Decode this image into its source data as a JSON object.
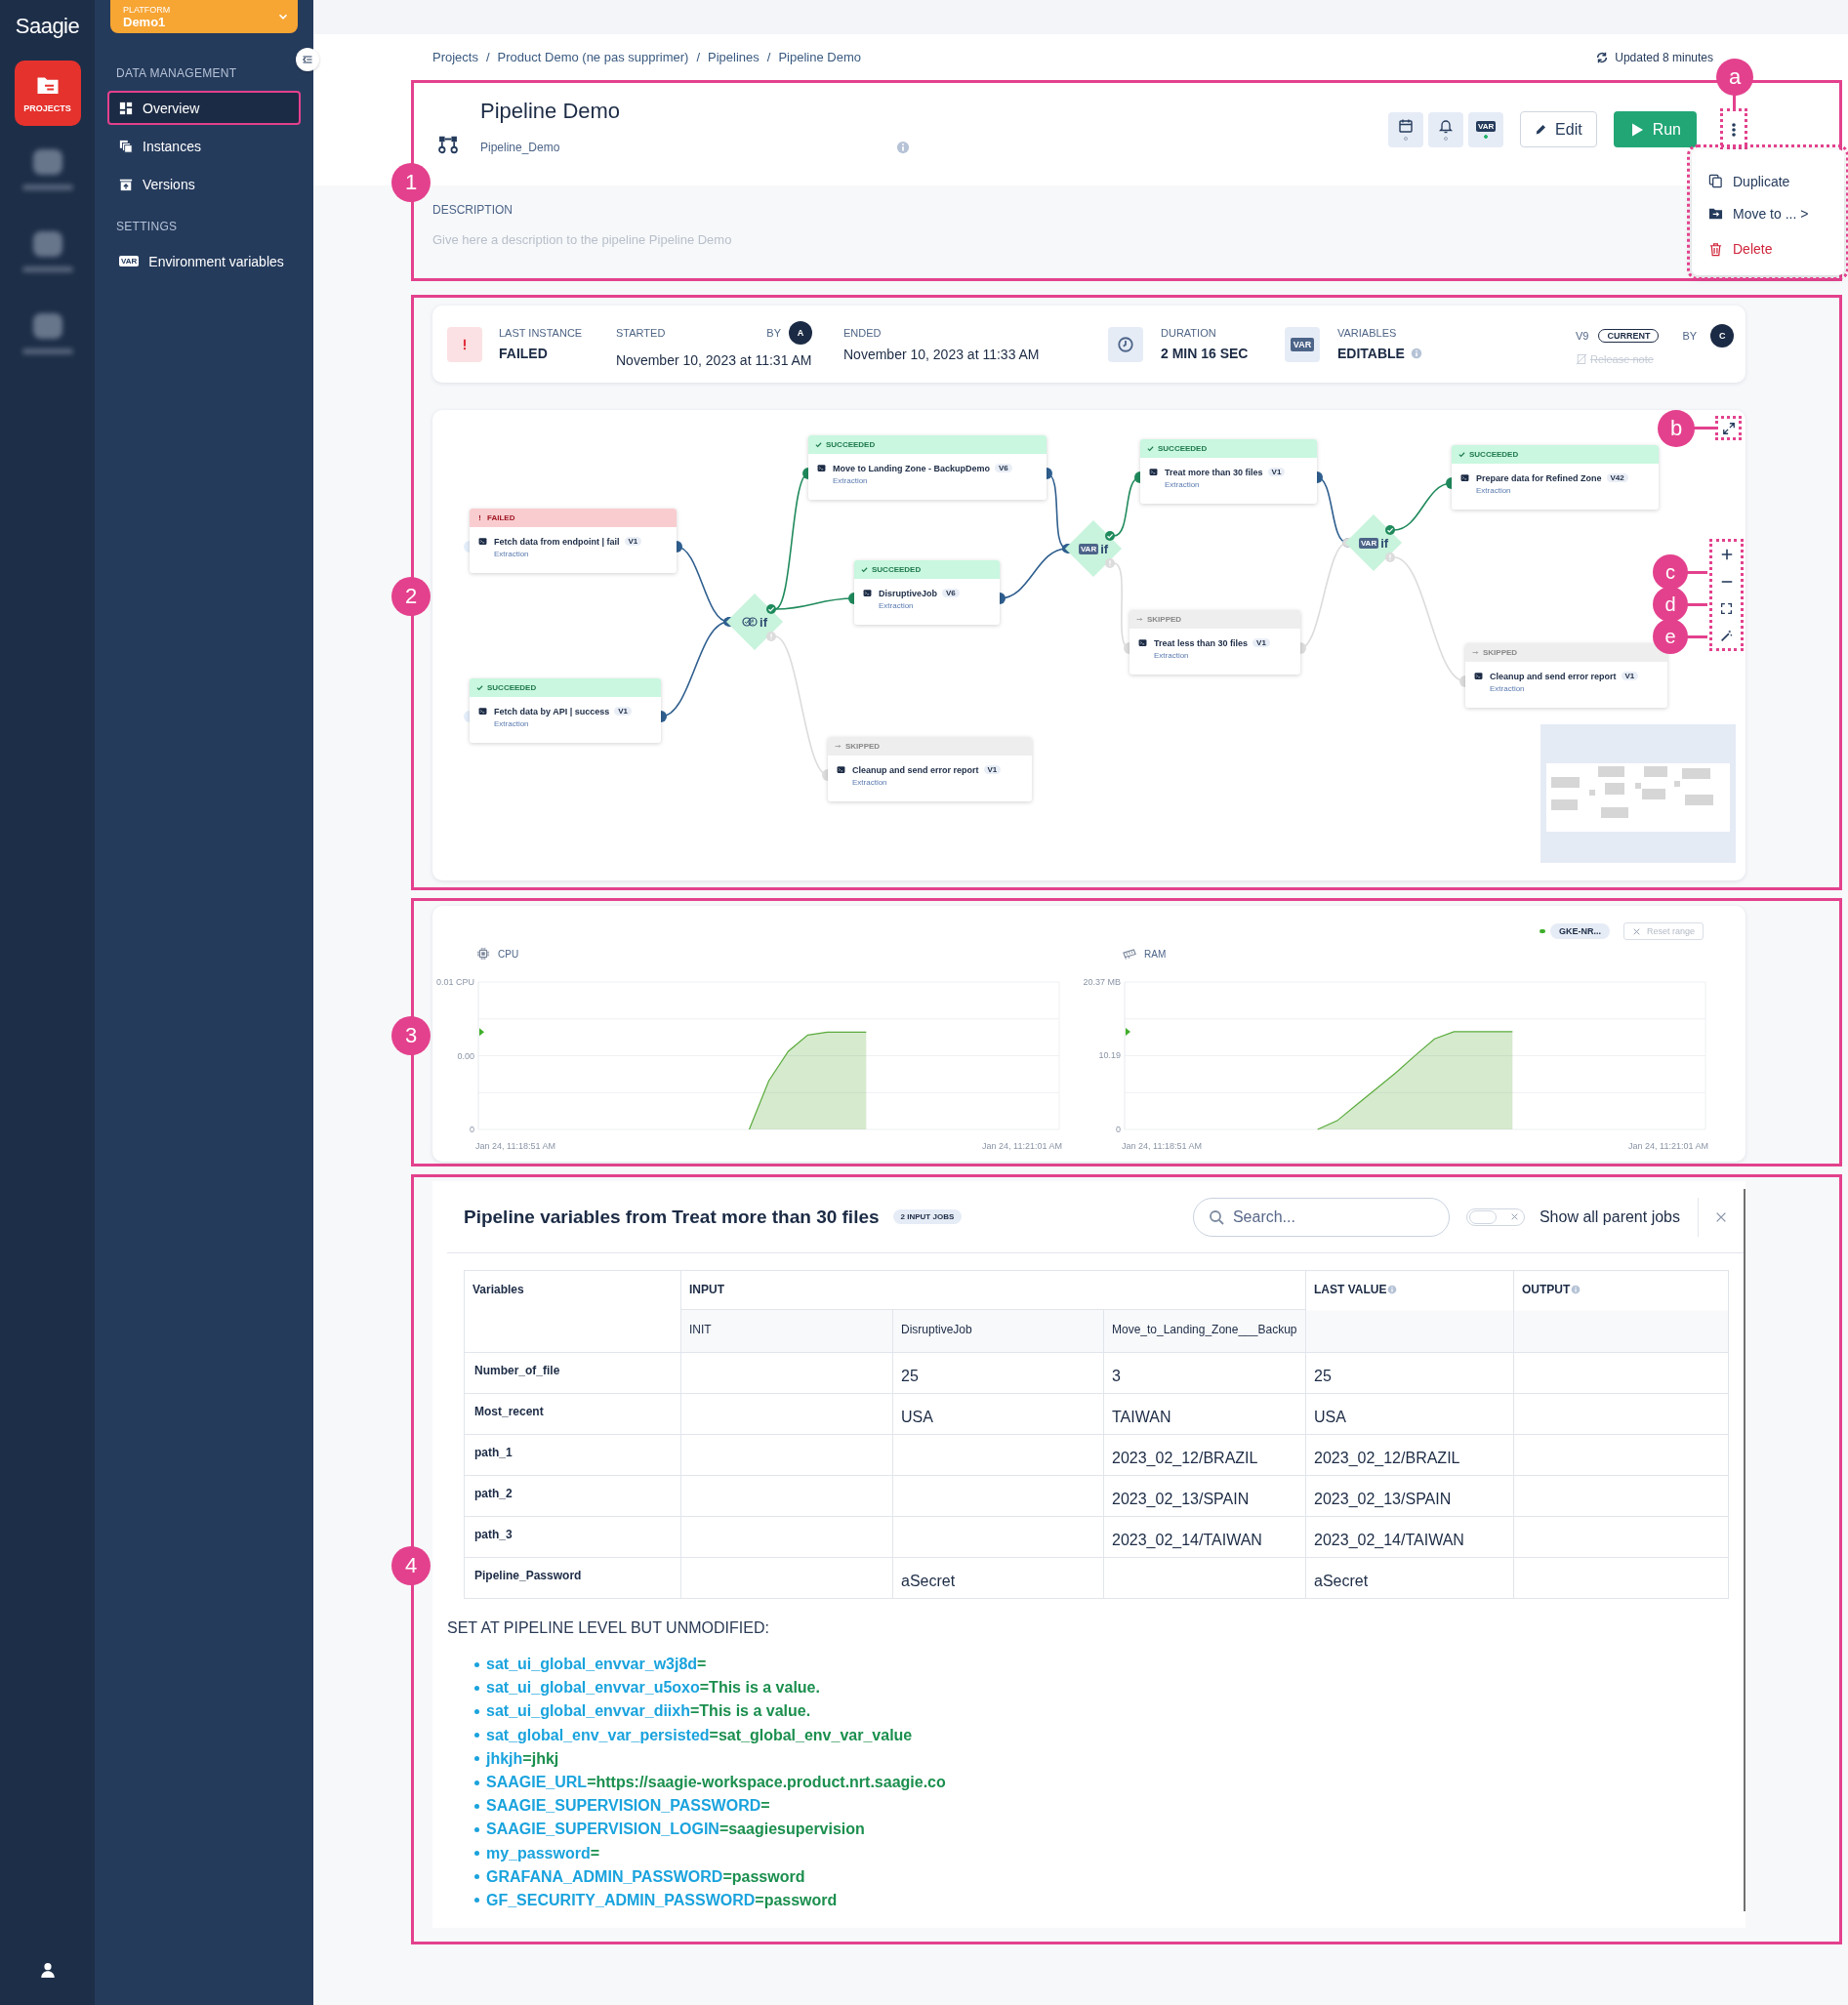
{
  "rail": {
    "logo": "Saagie",
    "items": [
      {
        "label": "PROJECTS",
        "selected": true
      }
    ]
  },
  "platform": {
    "caption": "PLATFORM",
    "name": "Demo1"
  },
  "sidebar": {
    "sections": [
      {
        "title": "DATA MANAGEMENT",
        "items": [
          {
            "label": "Overview",
            "selected": true
          },
          {
            "label": "Instances",
            "selected": false
          },
          {
            "label": "Versions",
            "selected": false
          }
        ]
      },
      {
        "title": "SETTINGS",
        "items": [
          {
            "label": "Environment variables",
            "icon_text": "VAR",
            "selected": false
          }
        ]
      }
    ]
  },
  "breadcrumb": {
    "items": [
      "Projects",
      "Product Demo (ne pas supprimer)",
      "Pipelines",
      "Pipeline Demo"
    ],
    "separator": "/"
  },
  "updated": "Updated 8 minutes",
  "pipeline": {
    "title": "Pipeline Demo",
    "technical_name": "Pipeline_Demo",
    "tools": [
      {
        "kind": "calendar",
        "active": false
      },
      {
        "kind": "bell",
        "active": false
      },
      {
        "kind": "var",
        "icon_text": "VAR",
        "active": true
      }
    ],
    "edit": "Edit",
    "run": "Run",
    "menu": [
      {
        "kind": "duplicate",
        "label": "Duplicate"
      },
      {
        "kind": "move",
        "label": "Move to ... >"
      },
      {
        "kind": "delete",
        "label": "Delete"
      }
    ],
    "description": {
      "label": "DESCRIPTION",
      "placeholder": "Give here a description to the pipeline Pipeline Demo"
    }
  },
  "instance": {
    "kind": "failed",
    "status_label": "LAST INSTANCE",
    "status_text": "FAILED",
    "started_label": "STARTED",
    "started": "November 10, 2023 at 11:31 AM",
    "by_label": "BY",
    "started_by": "A",
    "ended_label": "ENDED",
    "ended": "November 10, 2023 at 11:33 AM",
    "duration_label": "DURATION",
    "duration": "2 MIN 16 SEC",
    "variables_label": "VARIABLES",
    "variables_icon_text": "VAR",
    "variables": "EDITABLE",
    "version": "V9",
    "version_badge": "CURRENT",
    "version_by_label": "BY",
    "version_by": "C",
    "release_note": "Release note",
    "release_note_disabled": true
  },
  "graph": {
    "nodes": [
      {
        "kind": "failed",
        "status_label": "FAILED",
        "name": "Fetch data from endpoint | fail",
        "version": "V1",
        "category": "Extraction"
      },
      {
        "kind": "succeeded",
        "status_label": "SUCCEEDED",
        "name": "Fetch data by API | success",
        "version": "V1",
        "category": "Extraction"
      },
      {
        "kind": "status_condition",
        "label": "if"
      },
      {
        "kind": "succeeded",
        "status_label": "SUCCEEDED",
        "name": "Move to Landing Zone - BackupDemo",
        "version": "V6",
        "category": "Extraction"
      },
      {
        "kind": "succeeded",
        "status_label": "SUCCEEDED",
        "name": "DisruptiveJob",
        "version": "V6",
        "category": "Extraction"
      },
      {
        "kind": "skipped",
        "status_label": "SKIPPED",
        "name": "Cleanup and send error report",
        "version": "V1",
        "category": "Extraction"
      },
      {
        "kind": "variable_condition",
        "icon_text": "VAR",
        "label": "if"
      },
      {
        "kind": "succeeded",
        "status_label": "SUCCEEDED",
        "name": "Treat more than 30 files",
        "version": "V1",
        "category": "Extraction"
      },
      {
        "kind": "skipped",
        "status_label": "SKIPPED",
        "name": "Treat less than 30 files",
        "version": "V1",
        "category": "Extraction"
      },
      {
        "kind": "variable_condition",
        "icon_text": "VAR",
        "label": "if"
      },
      {
        "kind": "succeeded",
        "status_label": "SUCCEEDED",
        "name": "Prepare data for Refined Zone",
        "version": "V42",
        "category": "Extraction"
      },
      {
        "kind": "skipped",
        "status_label": "SKIPPED",
        "name": "Cleanup and send error report",
        "version": "V1",
        "category": "Extraction"
      }
    ]
  },
  "monitoring": {
    "legend": {
      "label": "GKE-NR...",
      "color": "#3fae2a"
    },
    "reset": {
      "label": "Reset range",
      "disabled": true
    },
    "charts": [
      {
        "kind": "cpu",
        "chart_data": {
          "type": "area",
          "title": "CPU",
          "categories": [
            "Jan 24, 11:18:51 AM",
            null,
            null,
            null,
            null,
            null,
            null,
            null,
            null,
            null,
            null,
            null,
            null,
            null,
            null,
            null,
            null,
            null,
            null,
            null,
            null,
            null,
            null,
            null,
            null,
            null,
            "Jan 24, 11:21:01 AM"
          ],
          "series": [
            {
              "color": "#5aab3c",
              "values": [
                null,
                null,
                null,
                null,
                null,
                null,
                null,
                null,
                null,
                null,
                null,
                null,
                0,
                0.0033,
                0.0053,
                0.0064,
                0.0066,
                0.0066,
                0.0066,
                null,
                null,
                null,
                null,
                null,
                null,
                null,
                null
              ]
            }
          ],
          "ylim": [
            0,
            0.01
          ],
          "yticks": [
            {
              "value": 0,
              "label": "0"
            },
            {
              "value": 0.005,
              "label": "0.00"
            },
            {
              "value": 0.01,
              "label": "0.01 CPU"
            }
          ]
        }
      },
      {
        "kind": "ram",
        "chart_data": {
          "type": "area",
          "title": "RAM",
          "categories": [
            "Jan 24, 11:18:51 AM",
            null,
            null,
            null,
            null,
            null,
            null,
            null,
            null,
            null,
            null,
            null,
            null,
            null,
            null,
            null,
            null,
            null,
            null,
            null,
            null,
            null,
            null,
            null,
            null,
            null,
            "Jan 24, 11:21:01 AM"
          ],
          "series": [
            {
              "color": "#5aab3c",
              "values": [
                null,
                null,
                null,
                null,
                null,
                null,
                null,
                null,
                0,
                1.2,
                3.4,
                5.6,
                7.8,
                10.2,
                12.5,
                13.5,
                13.5,
                13.5,
                13.5,
                null,
                null,
                null,
                null,
                null,
                null,
                null,
                null
              ]
            }
          ],
          "ylim": [
            0,
            20.37
          ],
          "yticks": [
            {
              "value": 0,
              "label": "0"
            },
            {
              "value": 10.19,
              "label": "10.19"
            },
            {
              "value": 20.37,
              "label": "20.37 MB"
            }
          ]
        }
      }
    ]
  },
  "variables_panel": {
    "title": "Pipeline variables from **Treat more than 30 files**",
    "badge": "2 INPUT JOBS",
    "search": {
      "placeholder": "Search..."
    },
    "toggle": {
      "label": "Show all parent jobs",
      "on": false
    },
    "table": {
      "groups": [
        {
          "label": "Variables"
        },
        {
          "label": "INPUT",
          "columns": [
            "INIT",
            "DisruptiveJob",
            "Move_to_Landing_Zone___Backup"
          ]
        },
        {
          "label": "LAST VALUE",
          "info": true
        },
        {
          "label": "OUTPUT",
          "info": true
        }
      ],
      "rows": [
        {
          "name": "Number_of_file",
          "disruptive": "25",
          "move": "3",
          "last_value": "25"
        },
        {
          "name": "Most_recent",
          "disruptive": "USA",
          "move": "TAIWAN",
          "last_value": "USA"
        },
        {
          "name": "path_1",
          "move": "2023_02_12/BRAZIL",
          "last_value": "2023_02_12/BRAZIL"
        },
        {
          "name": "path_2",
          "move": "2023_02_13/SPAIN",
          "last_value": "2023_02_13/SPAIN"
        },
        {
          "name": "path_3",
          "move": "2023_02_14/TAIWAN",
          "last_value": "2023_02_14/TAIWAN"
        },
        {
          "name": "Pipeline_Password",
          "disruptive": "aSecret",
          "last_value": "aSecret"
        }
      ]
    },
    "unmodified_title": "SET AT PIPELINE LEVEL BUT UNMODIFIED:",
    "unmodified": [
      {
        "name": "sat_ui_global_envvar_w3j8d",
        "sep": "="
      },
      {
        "name": "sat_ui_global_envvar_u5oxo",
        "sep": "=",
        "value": "This is a value."
      },
      {
        "name": "sat_ui_global_envvar_diixh",
        "sep": "=",
        "value": "This is a value."
      },
      {
        "name": "sat_global_env_var_persisted",
        "sep": "=",
        "value": "sat_global_env_var_value"
      },
      {
        "name": "jhkjh",
        "sep": "=",
        "value": "jhkj"
      },
      {
        "name": "SAAGIE_URL",
        "sep": "=",
        "value": "https://saagie-workspace.product.nrt.saagie.co"
      },
      {
        "name": "SAAGIE_SUPERVISION_PASSWORD",
        "sep": "="
      },
      {
        "name": "SAAGIE_SUPERVISION_LOGIN",
        "sep": "=",
        "value": "saagiesupervision"
      },
      {
        "name": "my_password",
        "sep": "="
      },
      {
        "name": "GRAFANA_ADMIN_PASSWORD",
        "sep": "=",
        "value": "password"
      },
      {
        "name": "GF_SECURITY_ADMIN_PASSWORD",
        "sep": "=",
        "value": "password"
      }
    ]
  },
  "annotations": [
    {
      "label": "1"
    },
    {
      "label": "2"
    },
    {
      "label": "3"
    },
    {
      "label": "4"
    },
    {
      "label": "a"
    },
    {
      "label": "b"
    },
    {
      "label": "c"
    },
    {
      "label": "d"
    },
    {
      "label": "e"
    }
  ]
}
